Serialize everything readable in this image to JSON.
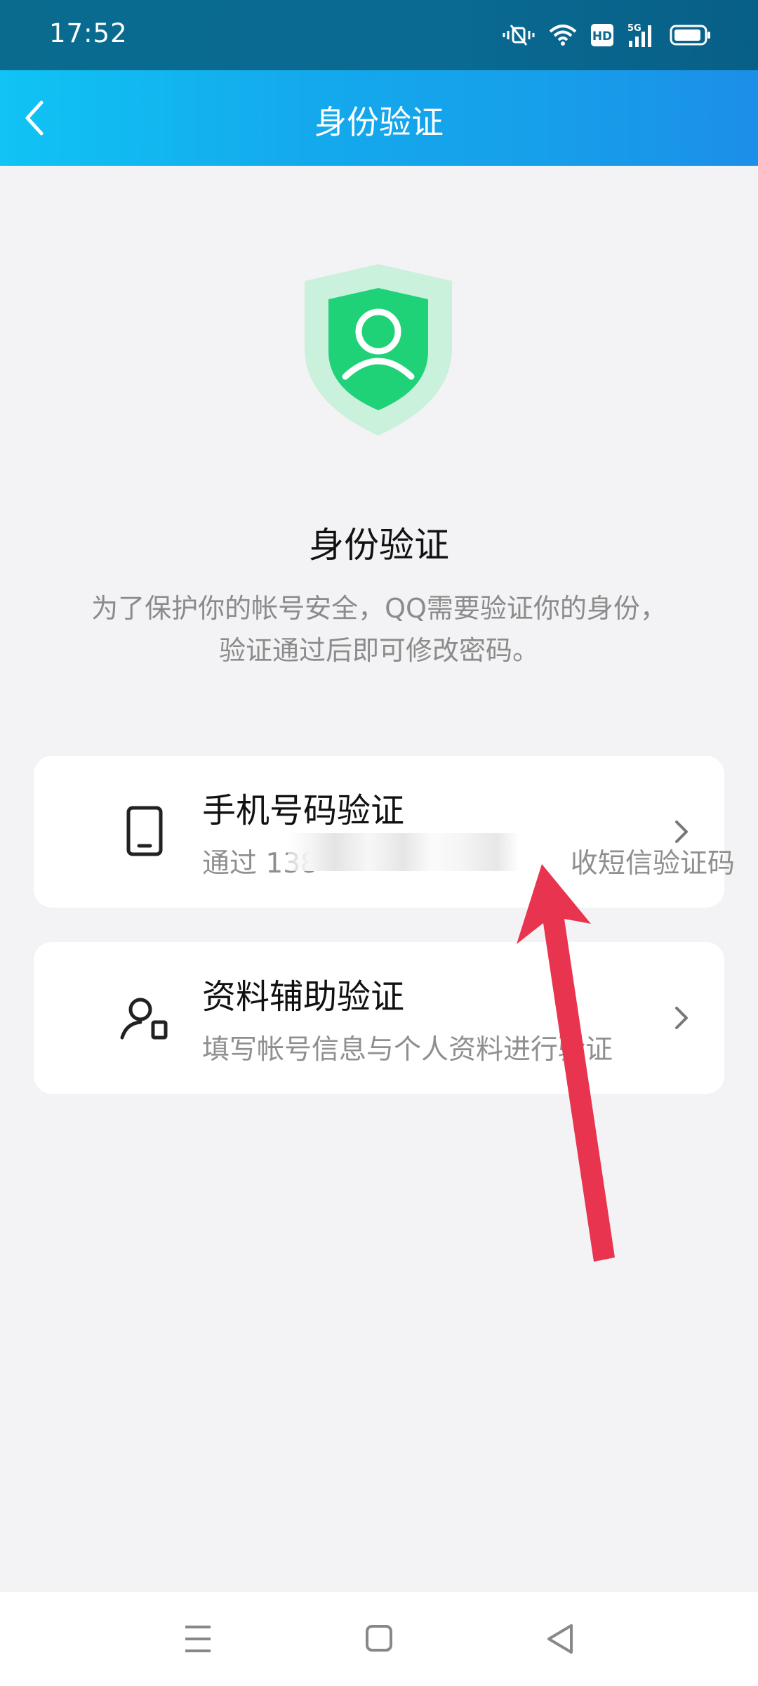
{
  "status_bar": {
    "time": "17:52",
    "icons": [
      "mute-vibrate-icon",
      "wifi-icon",
      "hd-icon",
      "5g-signal-icon",
      "battery-icon"
    ],
    "hd_label": "HD",
    "network_label": "5G"
  },
  "header": {
    "title": "身份验证",
    "back_icon": "chevron-left-icon"
  },
  "hero": {
    "icon": "shield-user-icon",
    "title": "身份验证",
    "description": "为了保护你的帐号安全，QQ需要验证你的身份，验证通过后即可修改密码。"
  },
  "options": [
    {
      "icon": "phone-icon",
      "title": "手机号码验证",
      "subtitle_prefix": "通过 138",
      "subtitle_suffix": "收短信验证码"
    },
    {
      "icon": "user-card-icon",
      "title": "资料辅助验证",
      "subtitle": "填写帐号信息与个人资料进行验证"
    }
  ],
  "nav_bar": {
    "icons": [
      "menu-icon",
      "home-icon",
      "back-triangle-icon"
    ]
  },
  "colors": {
    "header_gradient_start": "#10c4f5",
    "header_gradient_end": "#1c8fe8",
    "shield_outer": "#c9f1db",
    "shield_inner": "#1fd277",
    "annotation_arrow": "#e8344e",
    "background": "#f3f3f5"
  }
}
